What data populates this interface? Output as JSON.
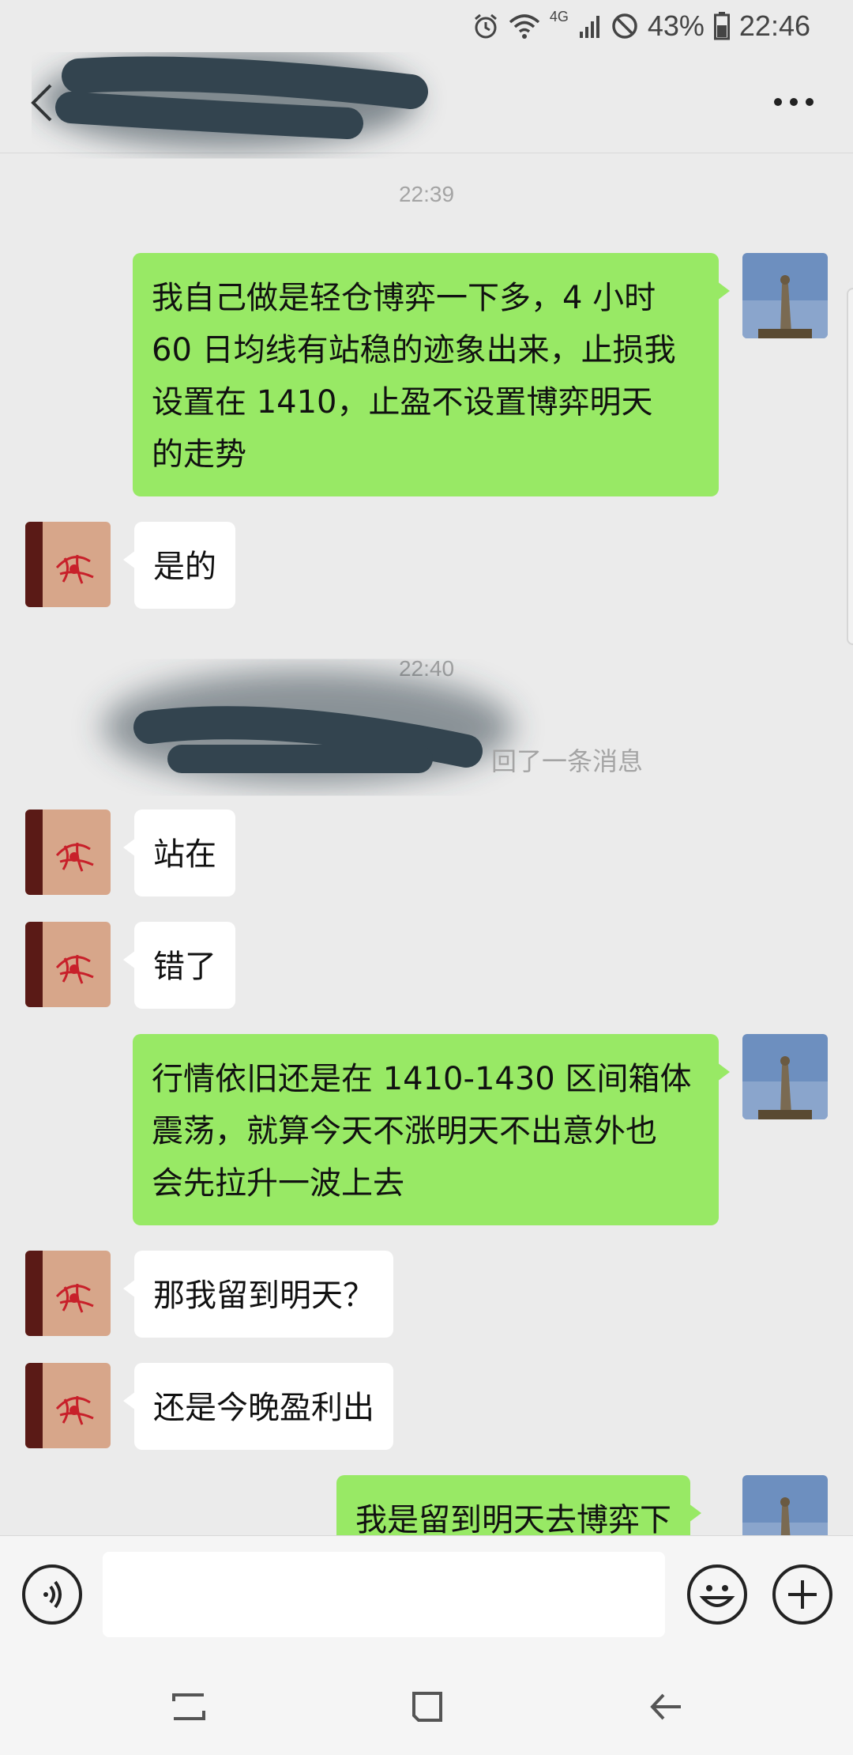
{
  "status_bar": {
    "battery": "43%",
    "time": "22:46",
    "network": "4G"
  },
  "header": {
    "title": "",
    "back_icon": "chevron-left-icon",
    "more_icon": "more-dots-icon"
  },
  "messages": [
    {
      "type": "time",
      "text": "22:39"
    },
    {
      "type": "me",
      "text": "我自己做是轻仓博弈一下多，4 小时\n60 日均线有站稳的迹象出来，止损我\n设置在 1410，止盈不设置博弈明天\n的走势"
    },
    {
      "type": "other",
      "text": "是的"
    },
    {
      "type": "time",
      "text": "22:40"
    },
    {
      "type": "system",
      "text": "回了一条消息"
    },
    {
      "type": "other",
      "text": "站在"
    },
    {
      "type": "other",
      "text": "错了"
    },
    {
      "type": "me",
      "text": "行情依旧还是在 1410-1430 区间箱体\n震荡，就算今天不涨明天不出意外也\n会先拉升一波上去"
    },
    {
      "type": "other",
      "text": "那我留到明天？"
    },
    {
      "type": "other",
      "text": "还是今晚盈利出"
    },
    {
      "type": "me",
      "text": "我是留到明天去博弈下"
    }
  ],
  "input": {
    "placeholder": "",
    "voice_icon": "voice-icon",
    "emoji_icon": "emoji-icon",
    "plus_icon": "plus-icon"
  },
  "nav": {
    "recent_icon": "recent-apps-icon",
    "home_icon": "home-icon",
    "back_icon": "back-arrow-icon"
  },
  "colors": {
    "me_bubble": "#98e965",
    "other_bubble": "#ffffff",
    "background": "#ebebeb"
  }
}
